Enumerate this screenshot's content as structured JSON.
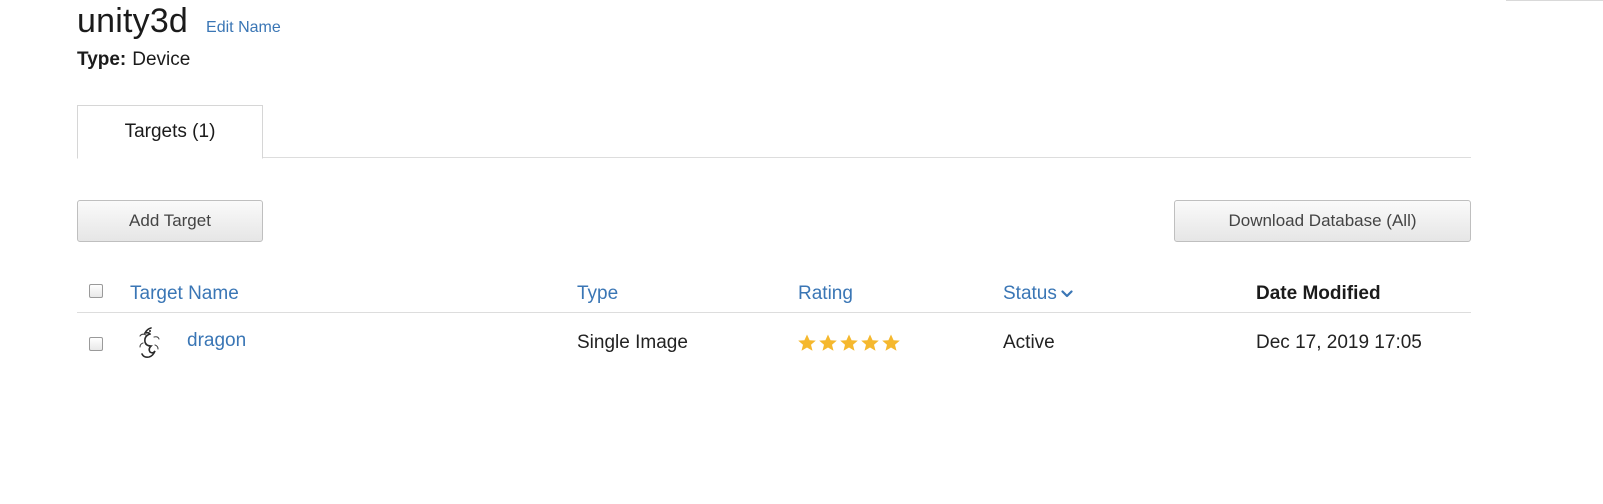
{
  "database": {
    "name": "unity3d",
    "edit_name_label": "Edit Name",
    "type_label": "Type:",
    "type_value": "Device"
  },
  "tabs": [
    {
      "label": "Targets (1)",
      "active": true
    }
  ],
  "actions": {
    "add_target_label": "Add Target",
    "download_label": "Download Database (All)"
  },
  "table": {
    "columns": {
      "target_name": "Target Name",
      "type": "Type",
      "rating": "Rating",
      "status": "Status",
      "date_modified": "Date Modified"
    },
    "rows": [
      {
        "target_name": "dragon",
        "type": "Single Image",
        "rating": 5,
        "status": "Active",
        "date_modified": "Dec 17, 2019 17:05"
      }
    ]
  },
  "colors": {
    "link": "#3a76b5",
    "star": "#f5b82e",
    "text": "#1b1b1b"
  }
}
